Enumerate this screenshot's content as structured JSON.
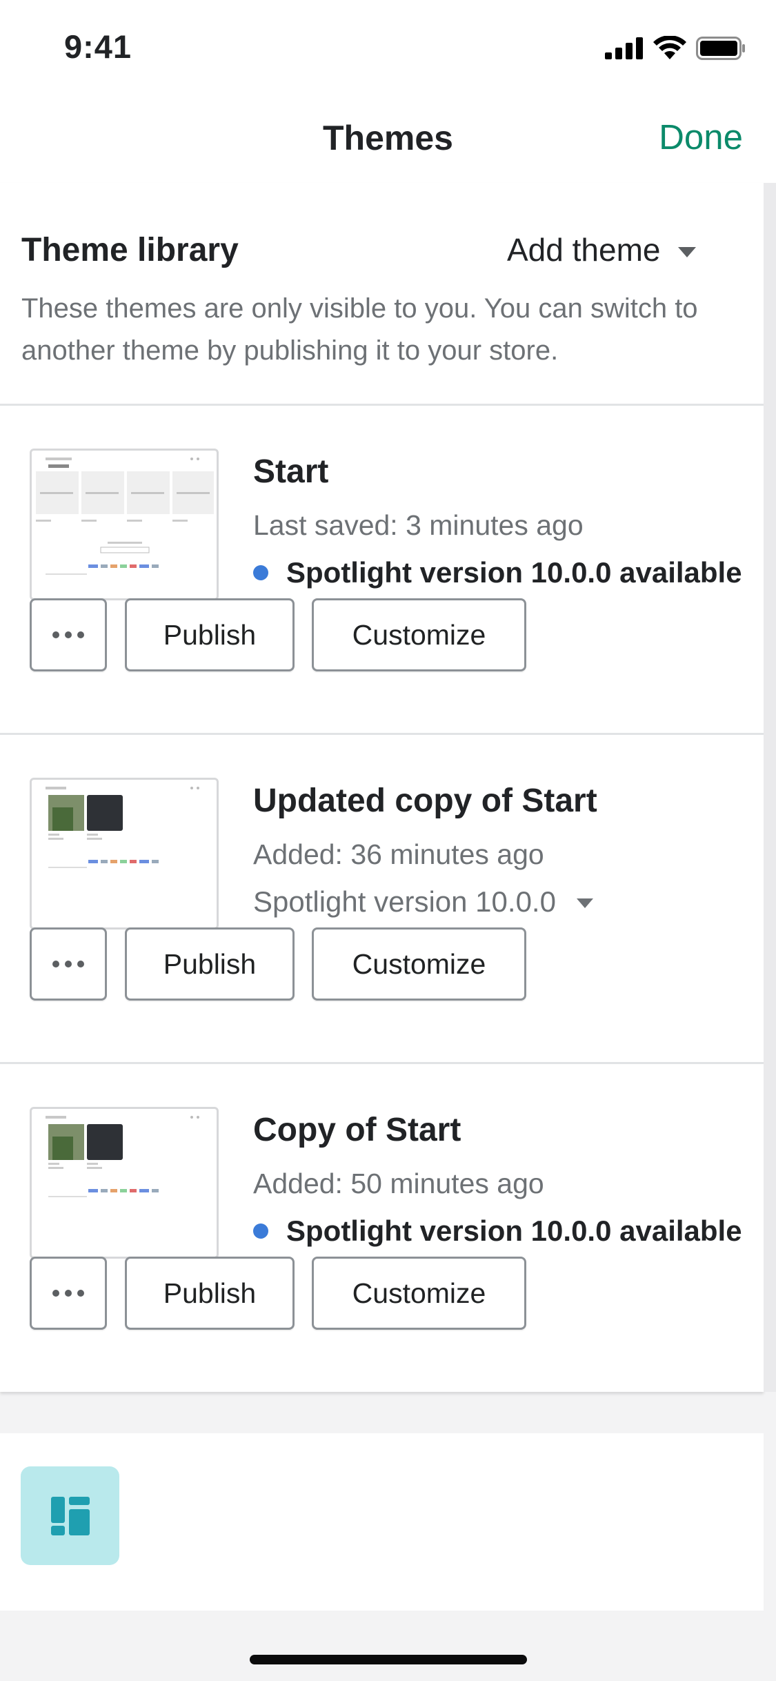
{
  "status_bar": {
    "time": "9:41"
  },
  "nav": {
    "title": "Themes",
    "done_label": "Done"
  },
  "library": {
    "title": "Theme library",
    "add_theme_label": "Add theme",
    "description": "These themes are only visible to you. You can switch to another theme by publishing it to your store."
  },
  "themes": [
    {
      "name": "Start",
      "meta": "Last saved: 3 minutes ago",
      "version": "Spotlight version 10.0.0 available",
      "version_style": "available",
      "publish_label": "Publish",
      "customize_label": "Customize"
    },
    {
      "name": "Updated copy of Start",
      "meta": "Added: 36 minutes ago",
      "version": "Spotlight version 10.0.0",
      "version_style": "dropdown",
      "publish_label": "Publish",
      "customize_label": "Customize"
    },
    {
      "name": "Copy of Start",
      "meta": "Added: 50 minutes ago",
      "version": "Spotlight version 10.0.0 available",
      "version_style": "available",
      "publish_label": "Publish",
      "customize_label": "Customize"
    }
  ],
  "colors": {
    "accent": "#0b8a6a",
    "dot": "#3b7bd8",
    "tile": "#b9e9ec",
    "tile_icon": "#1f9fb0"
  },
  "icons": {
    "more": "more-horizontal-icon",
    "caret": "caret-down-icon",
    "app": "layout-grid-icon"
  }
}
